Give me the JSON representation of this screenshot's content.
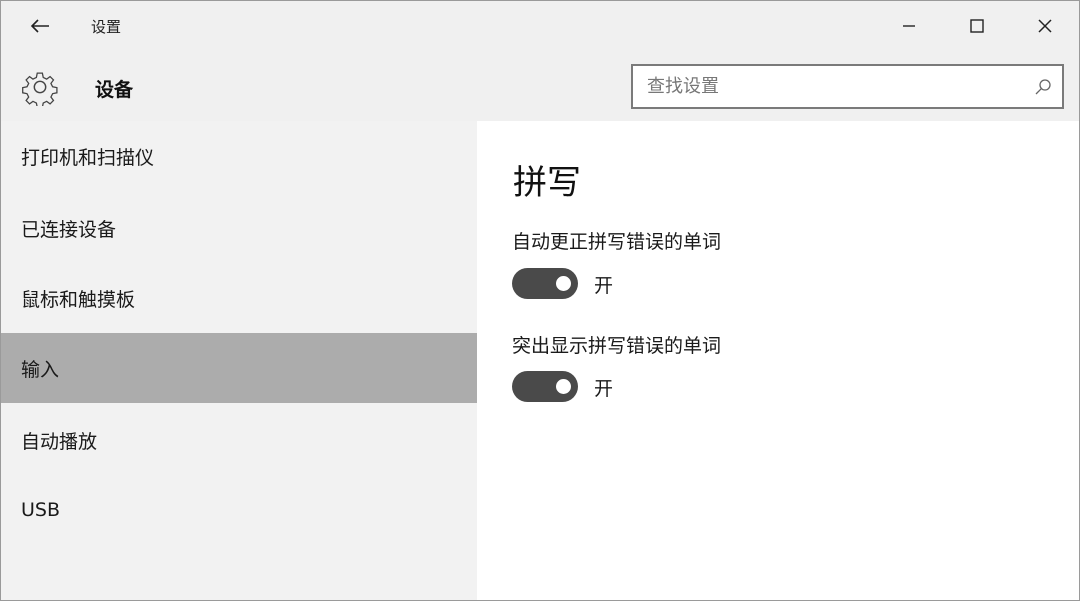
{
  "titlebar": {
    "back_icon": "back-arrow-icon",
    "title": "设置",
    "minimize_icon": "minimize-icon",
    "maximize_icon": "maximize-icon",
    "close_icon": "close-icon"
  },
  "header": {
    "icon": "gear-icon",
    "title": "设备",
    "search": {
      "placeholder": "查找设置",
      "value": "",
      "icon": "search-icon"
    }
  },
  "sidebar": {
    "items": [
      {
        "label": "打印机和扫描仪",
        "selected": false
      },
      {
        "label": "已连接设备",
        "selected": false
      },
      {
        "label": "鼠标和触摸板",
        "selected": false
      },
      {
        "label": "输入",
        "selected": true
      },
      {
        "label": "自动播放",
        "selected": false
      },
      {
        "label": "USB",
        "selected": false
      }
    ]
  },
  "content": {
    "section_title": "拼写",
    "settings": [
      {
        "label": "自动更正拼写错误的单词",
        "state": "开",
        "on": true
      },
      {
        "label": "突出显示拼写错误的单词",
        "state": "开",
        "on": true
      }
    ]
  },
  "colors": {
    "chrome_bg": "#f0f0f0",
    "sidebar_bg": "#f2f2f2",
    "selected_bg": "#acacac",
    "toggle_on": "#4a4a4a"
  }
}
